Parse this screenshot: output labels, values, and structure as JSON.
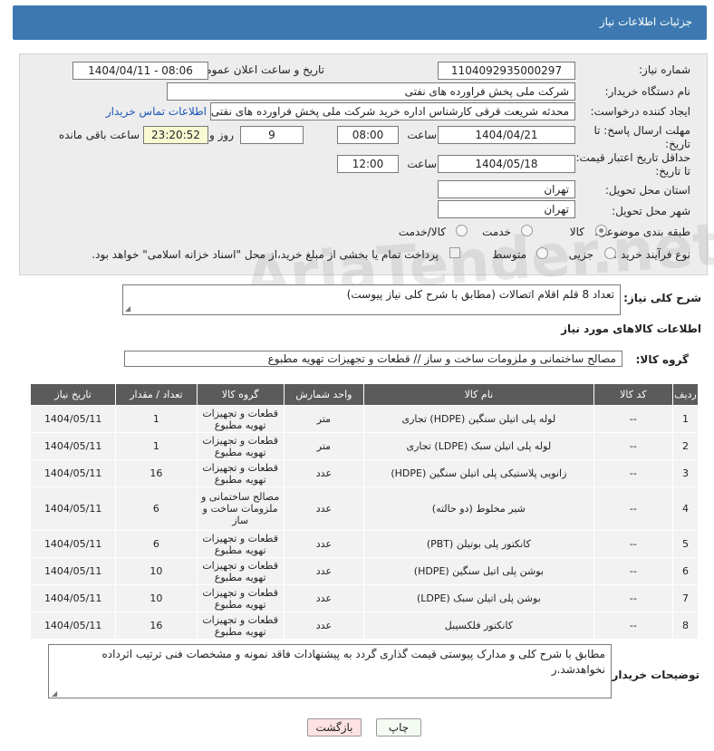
{
  "header": {
    "title": "جزئیات اطلاعات نیاز"
  },
  "form": {
    "need_number_label": "شماره نیاز:",
    "need_number": "1104092935000297",
    "announce_label": "تاریخ و ساعت اعلان عمومی:",
    "announce_value": "1404/04/11 - 08:06",
    "buyer_label": "نام دستگاه خریدار:",
    "buyer_value": "شرکت ملی پخش فراورده های نفتی",
    "creator_label": "ایجاد کننده درخواست:",
    "creator_value": "محدثه شریعت قرقی کارشناس اداره خرید  شرکت ملی پخش فراورده های نفتی",
    "contact_link": "اطلاعات تماس خریدار",
    "deadline_label": "مهلت ارسال پاسخ: تا تاریخ:",
    "deadline_date": "1404/04/21",
    "time_label": "ساعت",
    "deadline_time": "08:00",
    "days_value": "9",
    "days_label": "روز و",
    "remaining_time": "23:20:52",
    "remaining_label": "ساعت باقی مانده",
    "validity_label": "حداقل تاریخ اعتبار قیمت: تا تاریخ:",
    "validity_date": "1404/05/18",
    "validity_time_label": "ساعت",
    "validity_time": "12:00",
    "province_label": "استان محل تحویل:",
    "province_value": "تهران",
    "city_label": "شهر محل تحویل:",
    "city_value": "تهران",
    "category_label": "طبقه بندی موضوعی:",
    "category_options": [
      "کالا",
      "خدمت",
      "کالا/خدمت"
    ],
    "category_selected": "کالا",
    "process_label": "نوع فرآیند خرید :",
    "process_options": [
      "جزیی",
      "متوسط"
    ],
    "payment_note": "پرداخت تمام یا بخشی از مبلغ خرید،از محل \"اسناد خزانه اسلامی\" خواهد بود."
  },
  "summary": {
    "label": "شرح کلی نیاز:",
    "value": "تعداد 8 قلم اقلام اتصالات (مطابق با شرح کلی نیاز پیوست)"
  },
  "goods_section_title": "اطلاعات کالاهای مورد نیاز",
  "goods_group": {
    "label": "گروه کالا:",
    "value": "مصالح ساختمانی و ملزومات ساخت و ساز //  قطعات و تجهیزات تهویه مطبوع"
  },
  "table": {
    "headers": [
      "ردیف",
      "کد کالا",
      "نام کالا",
      "واحد شمارش",
      "گروه کالا",
      "تعداد / مقدار",
      "تاریخ نیاز"
    ],
    "rows": [
      [
        "1",
        "--",
        "لوله پلی اتیلن سنگین (HDPE) تجاری",
        "متر",
        "قطعات و تجهیزات تهویه مطبوع",
        "1",
        "1404/05/11"
      ],
      [
        "2",
        "--",
        "لوله پلی اتیلن سبک (LDPE) تجاری",
        "متر",
        "قطعات و تجهیزات تهویه مطبوع",
        "1",
        "1404/05/11"
      ],
      [
        "3",
        "--",
        "زانویی پلاستیکی پلی اتیلن سنگین (HDPE)",
        "عدد",
        "قطعات و تجهیزات تهویه مطبوع",
        "16",
        "1404/05/11"
      ],
      [
        "4",
        "--",
        "شیر مخلوط (دو حالته)",
        "عدد",
        "مصالح ساختمانی و ملزومات ساخت و ساز",
        "6",
        "1404/05/11"
      ],
      [
        "5",
        "--",
        "کانکتور پلی بوتیلن (PBT)",
        "عدد",
        "قطعات و تجهیزات تهویه مطبوع",
        "6",
        "1404/05/11"
      ],
      [
        "6",
        "--",
        "بوشن پلی اتیل سنگین (HDPE)",
        "عدد",
        "قطعات و تجهیزات تهویه مطبوع",
        "10",
        "1404/05/11"
      ],
      [
        "7",
        "--",
        "بوشن پلی اتیلن سبک (LDPE)",
        "عدد",
        "قطعات و تجهیزات تهویه مطبوع",
        "10",
        "1404/05/11"
      ],
      [
        "8",
        "--",
        "کانکتور فلکسیبل",
        "عدد",
        "قطعات و تجهیزات تهویه مطبوع",
        "16",
        "1404/05/11"
      ]
    ]
  },
  "buyer_notes": {
    "label": "توضیحات خریدار:",
    "value": "مطابق با شرح کلی و مدارک پیوستی قیمت گذاری گردد به پیشنهادات فاقد نمونه و مشخصات فنی ترتیب اثرداده نخواهدشد.ر"
  },
  "buttons": {
    "print": "چاپ",
    "back": "بازگشت"
  },
  "watermark": "AriaTender.net",
  "colors": {
    "header_bg": "#3d79b0",
    "table_header_bg": "#5b5b5b",
    "link": "#1a55b8"
  }
}
